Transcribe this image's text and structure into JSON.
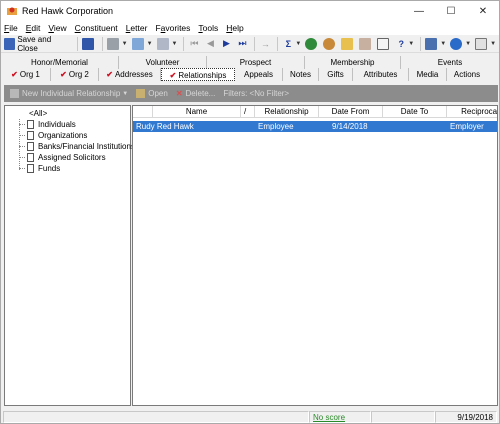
{
  "window": {
    "title": "Red Hawk Corporation",
    "controls": {
      "minimize": "—",
      "maximize": "☐",
      "close": "✕"
    }
  },
  "menu": [
    {
      "label": "File",
      "u": "F",
      "rest": "ile"
    },
    {
      "label": "Edit",
      "u": "E",
      "rest": "dit"
    },
    {
      "label": "View",
      "u": "V",
      "rest": "iew"
    },
    {
      "label": "Constituent",
      "u": "C",
      "rest": "onstituent"
    },
    {
      "label": "Letter",
      "u": "L",
      "rest": "etter"
    },
    {
      "label": "Favorites",
      "pre": "F",
      "u": "a",
      "rest": "vorites"
    },
    {
      "label": "Tools",
      "u": "T",
      "rest": "ools"
    },
    {
      "label": "Help",
      "u": "H",
      "rest": "elp"
    }
  ],
  "toolbar": {
    "save_and_close": "Save and Close",
    "icons": [
      "save-close-icon",
      "save-icon",
      "print-icon",
      "preview-icon",
      "props-icon",
      "first-icon",
      "prev-icon",
      "next-icon",
      "last-icon",
      "goto-icon",
      "sum-icon",
      "tree-icon",
      "refresh-icon",
      "folder-icon",
      "card-icon",
      "envelope-icon",
      "help-icon",
      "tools-icon",
      "web-icon",
      "notes-icon"
    ]
  },
  "tabs_row1": [
    "Honor/Memorial",
    "Volunteer",
    "Prospect",
    "Membership",
    "Events"
  ],
  "tabs_row2": [
    {
      "label": "Org 1",
      "check": true
    },
    {
      "label": "Org 2",
      "check": true
    },
    {
      "label": "Addresses",
      "check": true
    },
    {
      "label": "Relationships",
      "check": true,
      "active": true
    },
    {
      "label": "Appeals",
      "check": false
    },
    {
      "label": "Notes",
      "check": false
    },
    {
      "label": "Gifts",
      "check": false
    },
    {
      "label": "Attributes",
      "check": false
    },
    {
      "label": "Media",
      "check": false
    },
    {
      "label": "Actions",
      "check": false
    }
  ],
  "subtoolbar": {
    "new_relationship": "New Individual Relationship",
    "open": "Open",
    "delete": "Delete...",
    "filters": "Filters: <No Filter>"
  },
  "tree": {
    "root": "<All>",
    "items": [
      "Individuals",
      "Organizations",
      "Banks/Financial Institutions",
      "Assigned Solicitors",
      "Funds"
    ]
  },
  "grid": {
    "columns": [
      "",
      "Name",
      "/",
      "Relationship",
      "Date From",
      "Date To",
      "Reciprocal"
    ],
    "rows": [
      {
        "name": "Rudy Red Hawk",
        "relationship": "Employee",
        "date_from": "9/14/2018",
        "date_to": "",
        "reciprocal": "Employer"
      }
    ]
  },
  "status": {
    "score": "No score",
    "date": "9/19/2018"
  },
  "colors": {
    "selection": "#3178d0",
    "subtoolbar_bg": "#8c8c8c",
    "check": "#d01020",
    "status_green": "#2a8a2a"
  }
}
